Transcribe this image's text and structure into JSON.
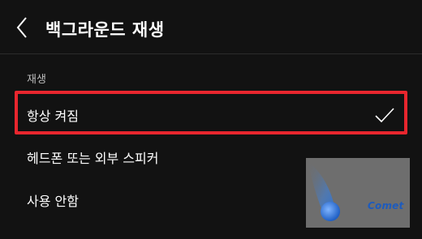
{
  "header": {
    "back_icon": "chevron-left-icon",
    "title": "백그라운드 재생"
  },
  "section": {
    "label": "재생"
  },
  "options": [
    {
      "label": "항상 켜짐",
      "selected": true
    },
    {
      "label": "헤드폰 또는 외부 스피커",
      "selected": false
    },
    {
      "label": "사용 안함",
      "selected": false
    }
  ],
  "check_icon": "checkmark-icon",
  "watermark": {
    "text": "Comet",
    "icon": "comet-logo"
  },
  "colors": {
    "background": "#121212",
    "text": "#ffffff",
    "section_label": "#bdbdbd",
    "highlight": "#e8262e"
  }
}
